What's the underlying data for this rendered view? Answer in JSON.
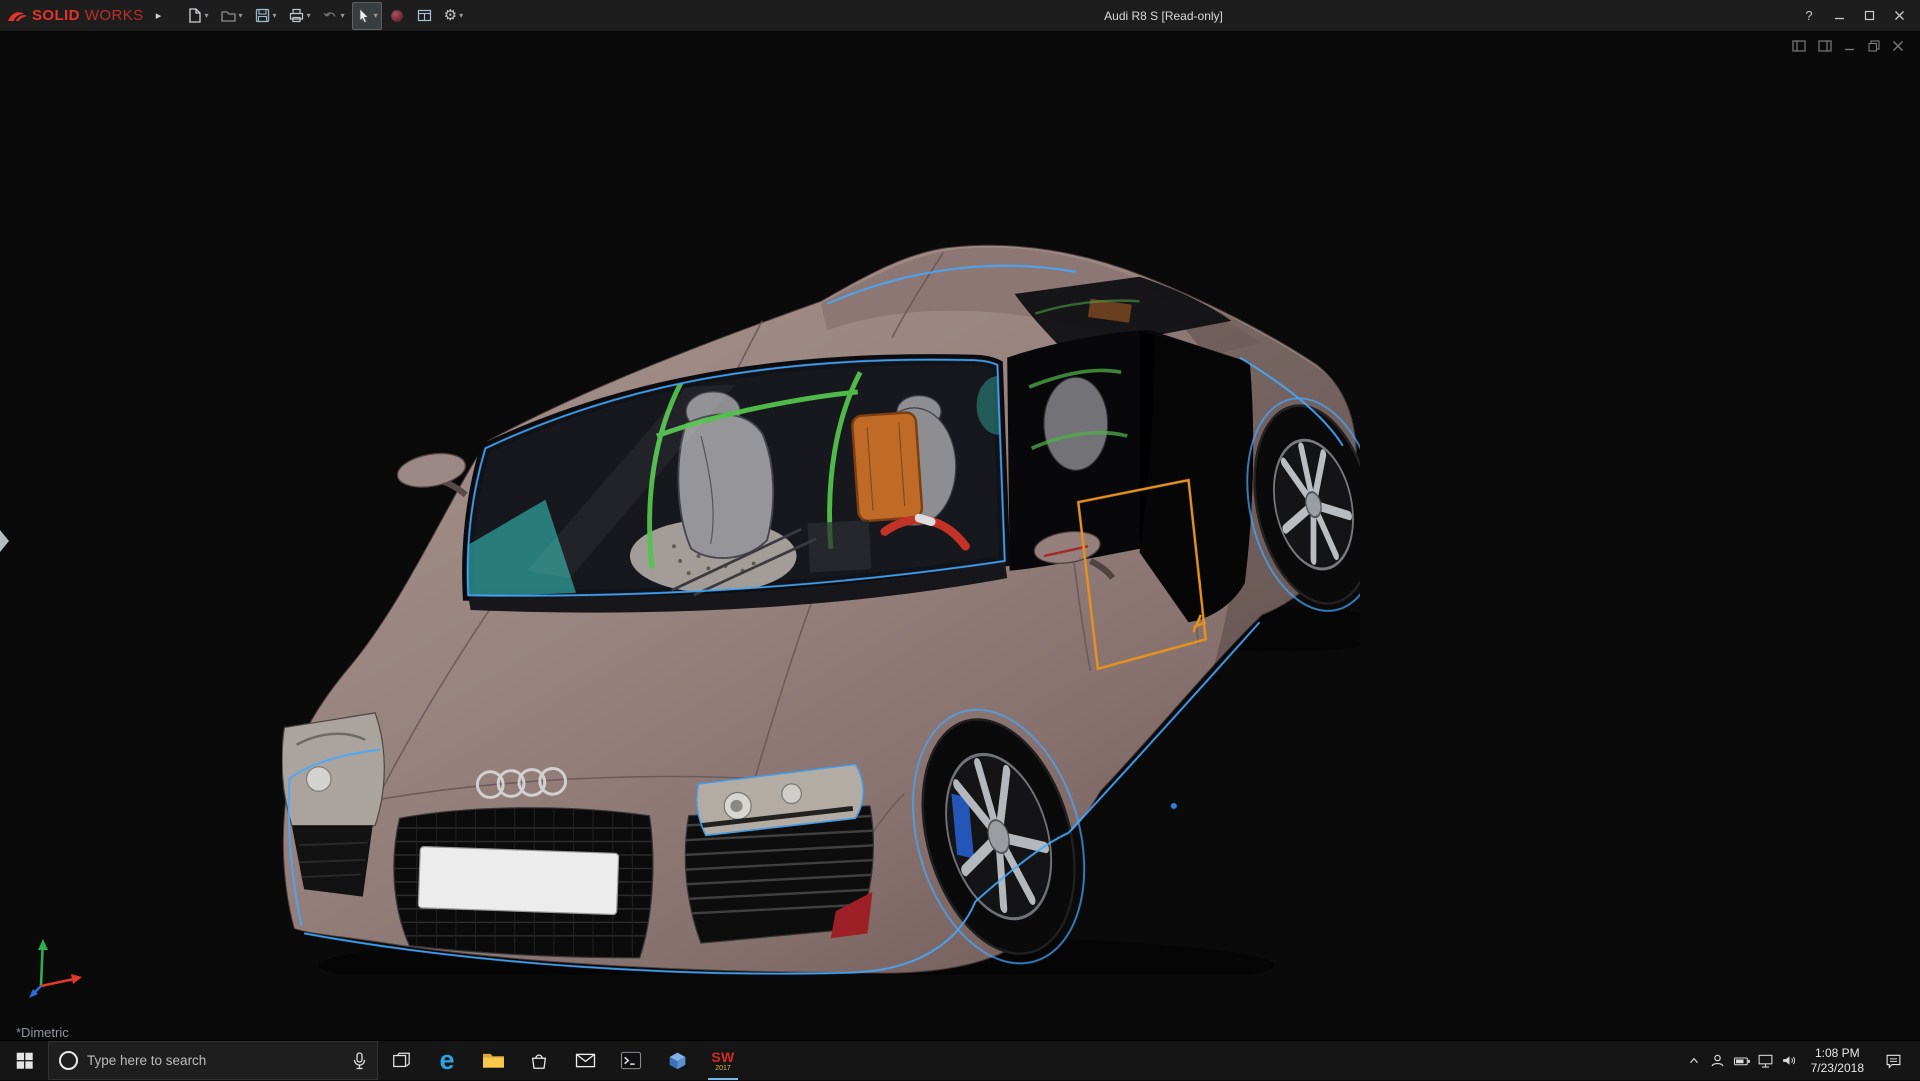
{
  "window": {
    "title": "Audi R8 S [Read-only]",
    "brand": {
      "part1": "SOLID",
      "part2": "WORKS"
    },
    "help_glyph": "?"
  },
  "titlebar": {
    "expand_glyph": "▸",
    "caret_glyph": "▾",
    "gear_glyph": "⚙",
    "tools": [
      "new-document",
      "open-document",
      "save",
      "print",
      "undo",
      "select",
      "appearances",
      "display-settings",
      "options"
    ]
  },
  "viewport": {
    "orientation_label": "*Dimetric",
    "model_name": "Audi R8 S",
    "background": "#0a0a0b",
    "body_color": "#9a8685",
    "selection_edge_color": "#46a9ff",
    "door_highlight_color": "#e6921e"
  },
  "doc_window": {
    "controls": [
      "pane-left",
      "pane-right",
      "minimize",
      "restore",
      "close"
    ]
  },
  "taskbar": {
    "search_placeholder": "Type here to search",
    "edge_glyph": "e",
    "sw_label": "SW",
    "sw_year": "2017",
    "apps": [
      "start",
      "task-view",
      "edge",
      "file-explorer",
      "store",
      "mail",
      "terminal",
      "3d-viewer",
      "solidworks-2017"
    ],
    "tray_icons": [
      "hidden-icons",
      "contacts",
      "battery",
      "network",
      "volume",
      "action-center"
    ],
    "clock": {
      "time": "1:08 PM",
      "date": "7/23/2018"
    }
  }
}
